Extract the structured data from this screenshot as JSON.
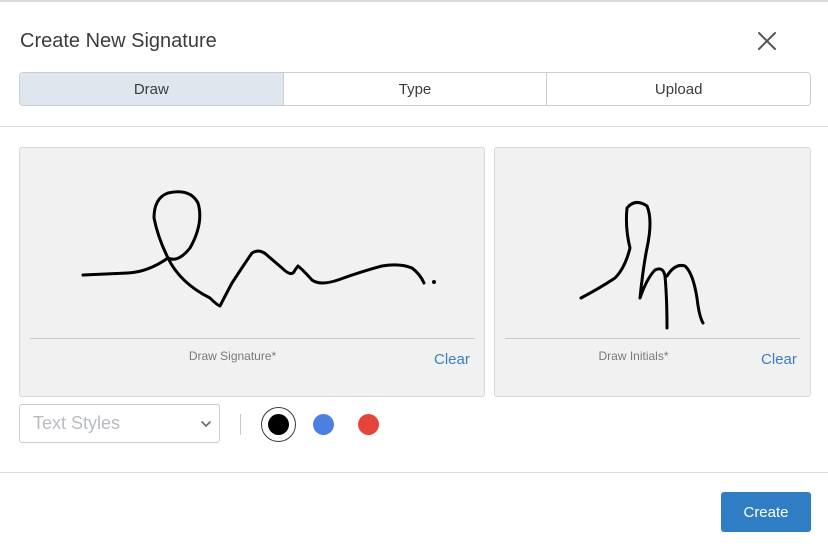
{
  "dialog": {
    "title": "Create New Signature",
    "close_icon": "close-icon"
  },
  "tabs": [
    {
      "label": "Draw",
      "active": true
    },
    {
      "label": "Type",
      "active": false
    },
    {
      "label": "Upload",
      "active": false
    }
  ],
  "signature_pad": {
    "caption": "Draw Signature*",
    "clear_label": "Clear"
  },
  "initials_pad": {
    "caption": "Draw Initials*",
    "clear_label": "Clear"
  },
  "text_styles": {
    "placeholder": "Text Styles",
    "icon": "chevron-down-icon"
  },
  "colors": {
    "ink_options": [
      "#000000",
      "#4d7fe3",
      "#e5443a"
    ],
    "selected": "#000000",
    "accent": "#2f7dc5"
  },
  "footer": {
    "create_label": "Create"
  }
}
